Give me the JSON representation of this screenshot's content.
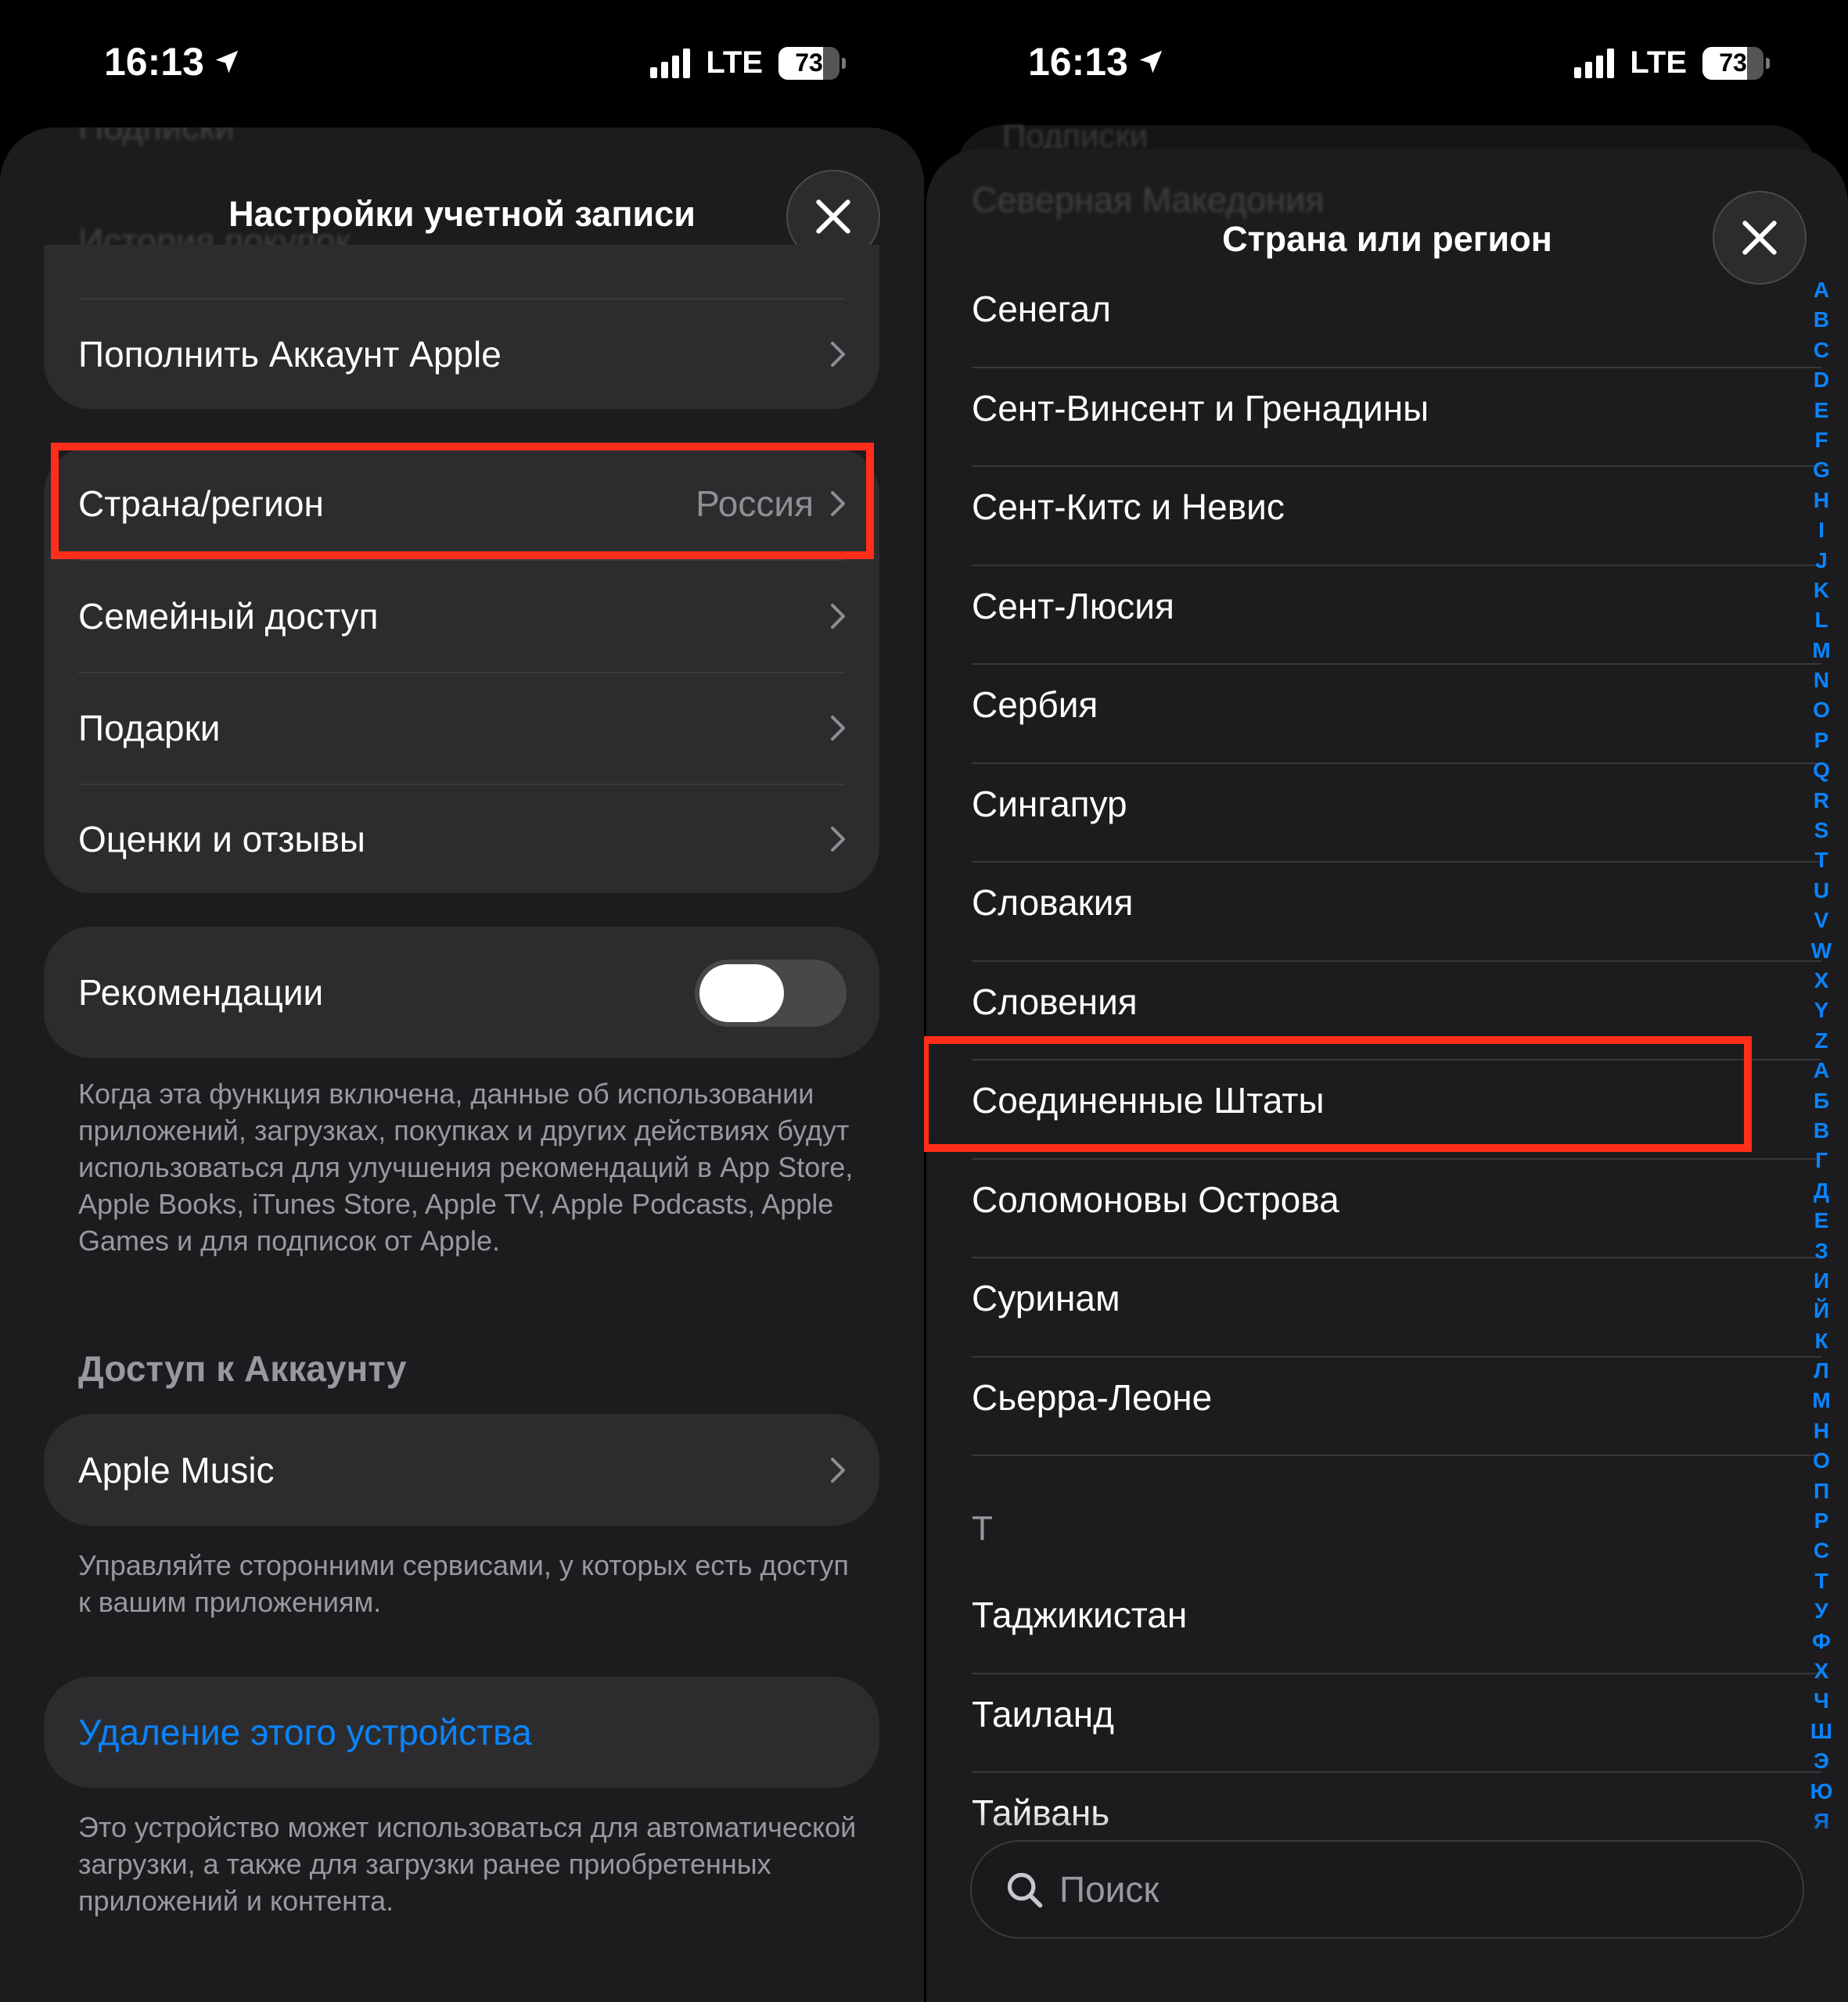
{
  "status_bar": {
    "time": "16:13",
    "network": "LTE",
    "battery": "73",
    "battery_level": 0.73
  },
  "left_sheet": {
    "title": "Настройки учетной записи",
    "ghost_top": "Подписки",
    "ghost_under_title": "История покупок",
    "group1": [
      {
        "label": "Пополнить Аккаунт Apple"
      }
    ],
    "group2": [
      {
        "label": "Страна/регион",
        "value": "Россия"
      },
      {
        "label": "Семейный доступ"
      },
      {
        "label": "Подарки"
      },
      {
        "label": "Оценки и отзывы"
      }
    ],
    "recommendations": {
      "label": "Рекомендации",
      "enabled": false
    },
    "recommendations_note": "Когда эта функция включена, данные об использовании приложений, загрузках, покупках и других действиях будут использоваться для улучшения рекомендаций в App Store, Apple Books, iTunes Store, Apple TV, Apple Podcasts, Apple Games и для подписок от Apple.",
    "account_access_header": "Доступ к Аккаунту",
    "apple_music": {
      "label": "Apple Music"
    },
    "account_access_note": "Управляйте сторонними сервисами, у которых есть доступ к вашим приложениям.",
    "remove_device": {
      "label": "Удаление этого устройства"
    },
    "remove_device_note": "Это устройство может использоваться для автоматической загрузки, а также для загрузки ранее приобретенных приложений и контента."
  },
  "right_sheet": {
    "title": "Страна или регион",
    "ghost_top": "Подписки",
    "ghost_under_title": "Северная Македония",
    "countries": [
      "Сенегал",
      "Сент-Винсент и Гренадины",
      "Сент-Китс и Невис",
      "Сент-Люсия",
      "Сербия",
      "Сингапур",
      "Словакия",
      "Словения",
      "Соединенные Штаты",
      "Соломоновы Острова",
      "Суринам",
      "Сьерра-Леоне"
    ],
    "section_letter": "Т",
    "countries_t": [
      "Таджикистан",
      "Таиланд",
      "Тайвань"
    ],
    "search_placeholder": "Поиск",
    "index_letters": [
      "A",
      "B",
      "C",
      "D",
      "E",
      "F",
      "G",
      "H",
      "I",
      "J",
      "K",
      "L",
      "M",
      "N",
      "O",
      "P",
      "Q",
      "R",
      "S",
      "T",
      "U",
      "V",
      "W",
      "X",
      "Y",
      "Z",
      "А",
      "Б",
      "В",
      "Г",
      "Д",
      "Е",
      "З",
      "И",
      "Й",
      "К",
      "Л",
      "М",
      "Н",
      "О",
      "П",
      "Р",
      "С",
      "Т",
      "У",
      "Ф",
      "Х",
      "Ч",
      "Ш",
      "Э",
      "Ю",
      "Я"
    ]
  },
  "colors": {
    "highlight": "#ff2d1a",
    "link": "#0a84ff",
    "index": "#0a84ff"
  }
}
